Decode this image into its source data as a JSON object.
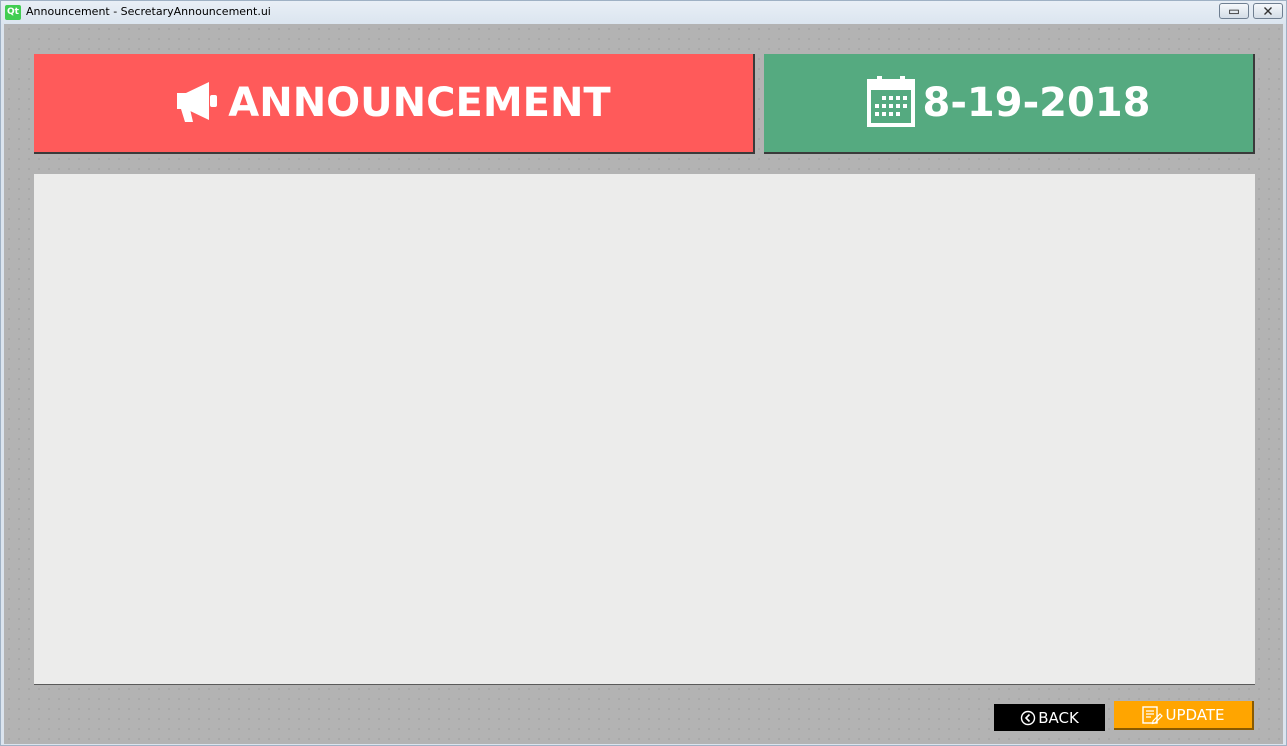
{
  "window": {
    "title": "Announcement - SecretaryAnnouncement.ui",
    "logo_text": "Qt"
  },
  "header": {
    "announcement_label": "ANNOUNCEMENT",
    "announcement_icon": "megaphone-icon",
    "date_label": "8-19-2018",
    "date_icon": "calendar-icon"
  },
  "content": {
    "text": ""
  },
  "buttons": {
    "back_label": "BACK",
    "back_icon": "chevron-left-circle-icon",
    "update_label": "UPDATE",
    "update_icon": "edit-note-icon"
  },
  "colors": {
    "announcement_bg": "#ff5a5a",
    "date_bg": "#55aa80",
    "content_bg": "#ececeb",
    "back_bg": "#000000",
    "update_bg": "#ffa500",
    "window_bg": "#b3b3b3"
  }
}
